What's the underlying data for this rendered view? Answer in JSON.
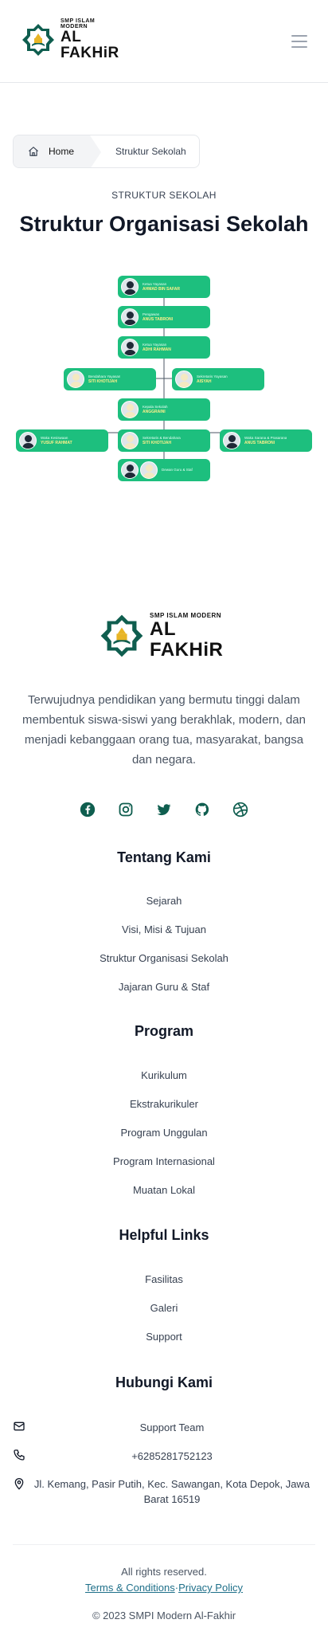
{
  "header": {
    "logo_sub": "SMP ISLAM MODERN",
    "logo_main": "AL FAKHiR",
    "menu_icon": "hamburger-icon"
  },
  "breadcrumb": {
    "home_icon": "home-icon",
    "home": "Home",
    "current": "Struktur Sekolah"
  },
  "page": {
    "kicker": "STRUKTUR SEKOLAH",
    "title": "Struktur Organisasi Sekolah"
  },
  "org_chart": {
    "nodes": [
      {
        "role": "Ketua Yayasan",
        "name": "AHMAD BIN SAFAR"
      },
      {
        "role": "Pengawas",
        "name": "ANUS TABRONI"
      },
      {
        "role": "Ketua Yayasan",
        "name": "ADHI RAHMAN"
      },
      {
        "role": "Bendahara Yayasan",
        "name": "SITI KHOTIJAH"
      },
      {
        "role": "Sekretaris Yayasan",
        "name": "AISYAH"
      },
      {
        "role": "Kepala Sekolah",
        "name": "ANGGRAINI"
      },
      {
        "role": "Waka Kesiswaan",
        "name": "YUSUF RAHMAT"
      },
      {
        "role": "Sekretaris & Bendahara",
        "name": "SITI KHOTIJAH"
      },
      {
        "role": "Waka Sarana & Prasarana",
        "name": "ANUS TABRONI"
      },
      {
        "role": "Dewan Guru & Staf",
        "name": ""
      }
    ]
  },
  "footer": {
    "logo_sub": "SMP ISLAM MODERN",
    "logo_main": "AL FAKHiR",
    "tagline": "Terwujudnya pendidikan yang bermutu tinggi dalam membentuk siswa-siswi yang berakhlak, modern, dan menjadi kebanggaan orang tua, masyarakat, bangsa dan negara.",
    "socials": [
      "facebook-icon",
      "instagram-icon",
      "twitter-icon",
      "github-icon",
      "dribbble-icon"
    ],
    "about": {
      "heading": "Tentang Kami",
      "links": [
        "Sejarah",
        "Visi, Misi & Tujuan",
        "Struktur Organisasi Sekolah",
        "Jajaran Guru & Staf"
      ]
    },
    "program": {
      "heading": "Program",
      "links": [
        "Kurikulum",
        "Ekstrakurikuler",
        "Program Unggulan",
        "Program Internasional",
        "Muatan Lokal"
      ]
    },
    "helpful": {
      "heading": "Helpful Links",
      "links": [
        "Fasilitas",
        "Galeri",
        "Support"
      ]
    },
    "contact": {
      "heading": "Hubungi Kami",
      "support": "Support Team",
      "phone": "+6285281752123",
      "address": "Jl. Kemang, Pasir Putih, Kec. Sawangan, Kota Depok, Jawa Barat 16519"
    },
    "rights": "All rights reserved.",
    "terms": "Terms & Conditions",
    "separator": "·",
    "privacy": "Privacy Policy",
    "copyright": "© 2023 SMPI Modern Al-Fakhir"
  },
  "colors": {
    "accent_green": "#1dbf7e",
    "icon_teal": "#0f5e4f",
    "link_blue": "#1e6f89"
  }
}
